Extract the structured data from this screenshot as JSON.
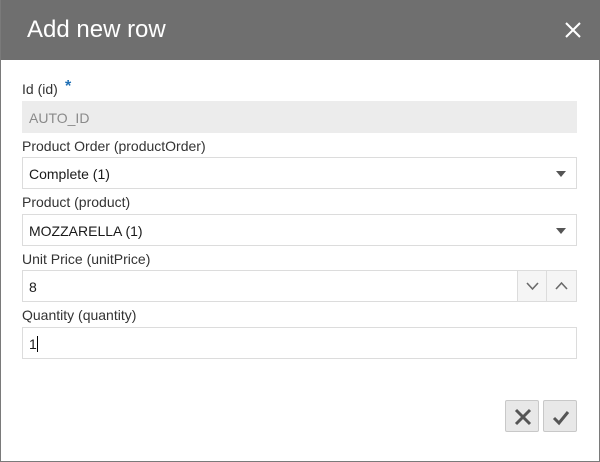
{
  "dialog": {
    "title": "Add new row"
  },
  "fields": {
    "id": {
      "label": "Id (id)",
      "required_marker": "*",
      "value": "AUTO_ID"
    },
    "product_order": {
      "label": "Product Order (productOrder)",
      "value": "Complete (1)"
    },
    "product": {
      "label": "Product (product)",
      "value": "MOZZARELLA (1)"
    },
    "unit_price": {
      "label": "Unit Price (unitPrice)",
      "value": "8"
    },
    "quantity": {
      "label": "Quantity (quantity)",
      "value": "1"
    }
  },
  "icons": {
    "close": "close-icon",
    "dropdown": "chevron-down-icon",
    "decrement": "chevron-down-icon",
    "increment": "chevron-up-icon",
    "cancel": "x-icon",
    "save": "checkmark-icon"
  },
  "colors": {
    "titlebar": "#6f6f6f",
    "required_marker": "#1f6fb5",
    "readonly_field": "#ececec"
  }
}
